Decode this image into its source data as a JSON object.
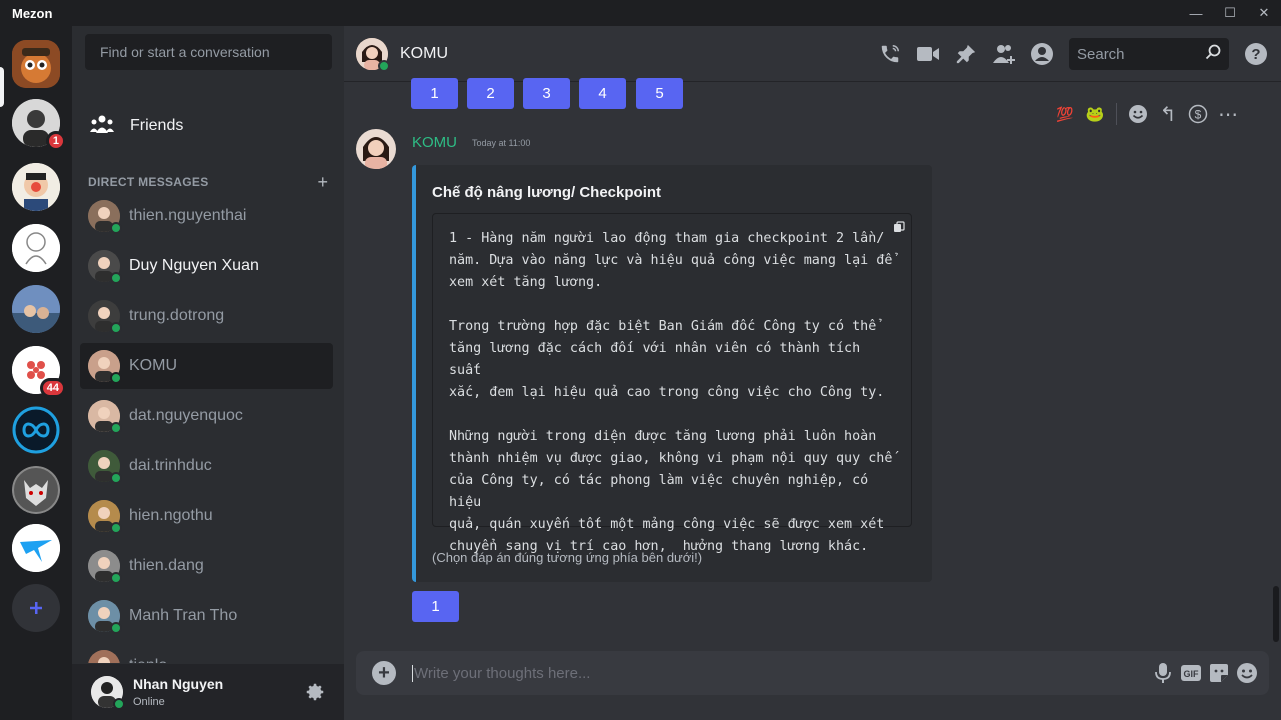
{
  "app": {
    "title": "Mezon",
    "controls": {
      "minimize": "—",
      "maximize": "☐",
      "close": "✕"
    }
  },
  "servers": [
    {
      "name": "server-1",
      "badge": ""
    },
    {
      "name": "server-2",
      "badge": "1"
    },
    {
      "name": "server-3",
      "badge": ""
    },
    {
      "name": "server-4",
      "badge": ""
    },
    {
      "name": "server-5",
      "badge": ""
    },
    {
      "name": "server-6",
      "badge": "44"
    },
    {
      "name": "server-7",
      "badge": ""
    },
    {
      "name": "server-8",
      "badge": ""
    },
    {
      "name": "server-9",
      "badge": ""
    }
  ],
  "sidebar": {
    "search_placeholder": "Find or start a conversation",
    "friends_label": "Friends",
    "dm_header": "DIRECT MESSAGES",
    "dm_add": "+",
    "dms": [
      {
        "name": "thien.nguyenthai",
        "bright": false,
        "color": "#8a6f5c"
      },
      {
        "name": "Duy Nguyen Xuan",
        "bright": true,
        "color": "#4a4a4a"
      },
      {
        "name": "trung.dotrong",
        "bright": false,
        "color": "#3d3d3d"
      },
      {
        "name": "KOMU",
        "bright": false,
        "color": "#c9a08b",
        "selected": true
      },
      {
        "name": "dat.nguyenquoc",
        "bright": false,
        "color": "#d9b8a3"
      },
      {
        "name": "dai.trinhduc",
        "bright": false,
        "color": "#3f5a3a"
      },
      {
        "name": "hien.ngothu",
        "bright": false,
        "color": "#b58b4c"
      },
      {
        "name": "thien.dang",
        "bright": false,
        "color": "#8c8c8c"
      },
      {
        "name": "Manh Tran Tho",
        "bright": false,
        "color": "#6d8fa6"
      },
      {
        "name": "tienlo",
        "bright": false,
        "color": "#a0705a"
      }
    ]
  },
  "user_panel": {
    "name": "Nhan Nguyen",
    "status": "Online"
  },
  "chat": {
    "title": "KOMU",
    "search_placeholder": "Search",
    "top_buttons": [
      "1",
      "2",
      "3",
      "4",
      "5"
    ],
    "message": {
      "author": "KOMU",
      "timestamp": "Today at 11:00",
      "embed_title": "Chế độ nâng lương/ Checkpoint",
      "code_text": "1 - Hàng năm người lao động tham gia checkpoint 2 lần/\nnăm. Dựa vào năng lực và hiệu quả công việc mang lại để\nxem xét tăng lương.\n\nTrong trường hợp đặc biệt Ban Giám đốc Công ty có thể\ntăng lương đặc cách đối với nhân viên có thành tích suất\nxắc, đem lại hiệu quả cao trong công việc cho Công ty.\n\nNhững người trong diện được tăng lương phải luôn hoàn\nthành nhiệm vụ được giao, không vi phạm nội quy quy chế\ncủa Công ty, có tác phong làm việc chuyên nghiệp, có hiệu\nquả, quán xuyến tốt một mảng công việc sẽ được xem xét\nchuyển sang vị trí cao hơn,  hưởng thang lương khác.",
      "embed_footer": "(Chọn đáp án đúng tương ứng phía bên dưới!)",
      "answer_buttons": [
        "1"
      ]
    },
    "toolbar": {
      "reaction_100": "💯",
      "reaction_pepe": "🐸",
      "reply": "↰",
      "more": "⋯"
    },
    "composer_placeholder": "Write your thoughts here...",
    "composer_gif": "GIF"
  },
  "colors": {
    "accent": "#5865f2",
    "online": "#23a55a",
    "author": "#2ebd85",
    "embed_border": "#3498db",
    "badge": "#da373c"
  }
}
